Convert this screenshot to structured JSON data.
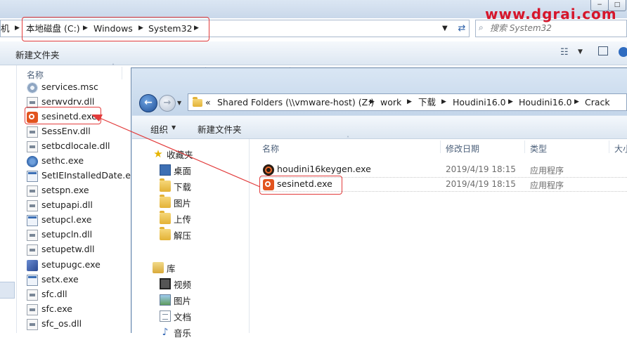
{
  "watermark": "www.dgrai.com",
  "background_window": {
    "window_buttons": [
      "−",
      "□"
    ],
    "breadcrumb": [
      "机",
      "本地磁盘 (C:)",
      "Windows",
      "System32"
    ],
    "search_placeholder": "搜索 System32",
    "toolbar": {
      "new_folder": "新建文件夹"
    },
    "column_name": "名称",
    "files": [
      {
        "name": "services.msc",
        "icon": "gear-icon"
      },
      {
        "name": "serwvdrv.dll",
        "icon": "dll-icon"
      },
      {
        "name": "sesinetd.exe",
        "icon": "houdini-icon"
      },
      {
        "name": "SessEnv.dll",
        "icon": "dll-icon"
      },
      {
        "name": "setbcdlocale.dll",
        "icon": "dll-icon"
      },
      {
        "name": "sethc.exe",
        "icon": "shield-icon"
      },
      {
        "name": "SetIEInstalledDate.exe",
        "icon": "exe-icon"
      },
      {
        "name": "setspn.exe",
        "icon": "dll-icon"
      },
      {
        "name": "setupapi.dll",
        "icon": "dll-icon"
      },
      {
        "name": "setupcl.exe",
        "icon": "exe-icon"
      },
      {
        "name": "setupcln.dll",
        "icon": "dll-icon"
      },
      {
        "name": "setupetw.dll",
        "icon": "dll-icon"
      },
      {
        "name": "setupugc.exe",
        "icon": "installer-icon"
      },
      {
        "name": "setx.exe",
        "icon": "exe-icon"
      },
      {
        "name": "sfc.dll",
        "icon": "dll-icon"
      },
      {
        "name": "sfc.exe",
        "icon": "dll-icon"
      },
      {
        "name": "sfc_os.dll",
        "icon": "dll-icon"
      }
    ]
  },
  "foreground_window": {
    "breadcrumb": [
      "«",
      "Shared Folders (\\\\vmware-host) (Z:)",
      "work",
      "下载",
      "Houdini16.0",
      "Houdini16.0",
      "Crack"
    ],
    "toolbar": {
      "organize": "组织",
      "new_folder": "新建文件夹"
    },
    "nav": {
      "favorites": "收藏夹",
      "favorites_items": [
        "桌面",
        "下载",
        "图片",
        "上传",
        "解压"
      ],
      "libraries": "库",
      "library_items": [
        "视频",
        "图片",
        "文档",
        "音乐"
      ]
    },
    "columns": {
      "name": "名称",
      "date": "修改日期",
      "type": "类型",
      "size": "大小"
    },
    "files": [
      {
        "name": "houdini16keygen.exe",
        "date": "2019/4/19 18:15",
        "type": "应用程序",
        "icon": "houdini-dark-icon"
      },
      {
        "name": "sesinetd.exe",
        "date": "2019/4/19 18:15",
        "type": "应用程序",
        "icon": "houdini-icon"
      }
    ]
  },
  "colors": {
    "annotation": "#e23b3b",
    "watermark": "#d6162b"
  }
}
